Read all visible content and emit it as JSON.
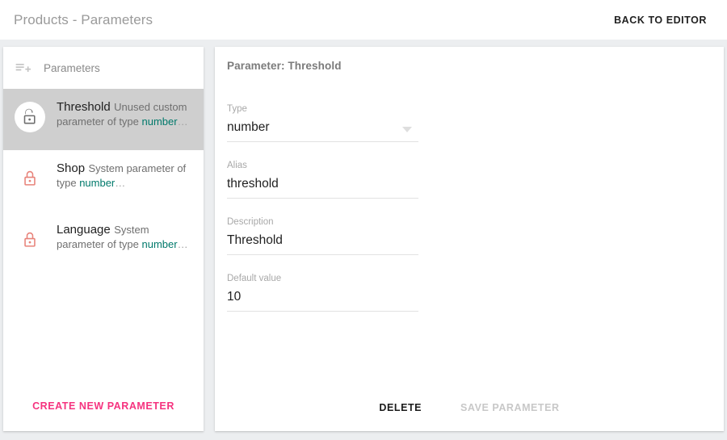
{
  "appbar": {
    "title": "Products - Parameters",
    "back_label": "BACK TO EDITOR"
  },
  "sidebar": {
    "header_label": "Parameters",
    "header_icon": "playlist-add-icon",
    "create_label": "CREATE NEW PARAMETER",
    "items": [
      {
        "name": "Threshold",
        "desc_prefix": "Unused custom parameter of type ",
        "desc_type": "number",
        "desc_ellipsis": "…",
        "icon": "lock-open-icon",
        "selected": true
      },
      {
        "name": "Shop",
        "desc_prefix": "System parameter of type ",
        "desc_type": "number",
        "desc_ellipsis": "…",
        "icon": "lock-closed-icon",
        "selected": false
      },
      {
        "name": "Language",
        "desc_prefix": "System parameter of type ",
        "desc_type": "number",
        "desc_ellipsis": "…",
        "icon": "lock-closed-icon",
        "selected": false
      }
    ]
  },
  "detail": {
    "title": "Parameter: Threshold",
    "fields": {
      "type": {
        "label": "Type",
        "value": "number"
      },
      "alias": {
        "label": "Alias",
        "value": "threshold"
      },
      "description": {
        "label": "Description",
        "value": "Threshold"
      },
      "default_value": {
        "label": "Default value",
        "value": "10"
      }
    },
    "delete_label": "DELETE",
    "save_label": "SAVE PARAMETER"
  },
  "colors": {
    "accent_pink": "#f5337f",
    "type_teal": "#00796b",
    "lock_red": "#e8837a",
    "page_bg": "#eceef0",
    "selected_row": "#cfcfcf"
  }
}
